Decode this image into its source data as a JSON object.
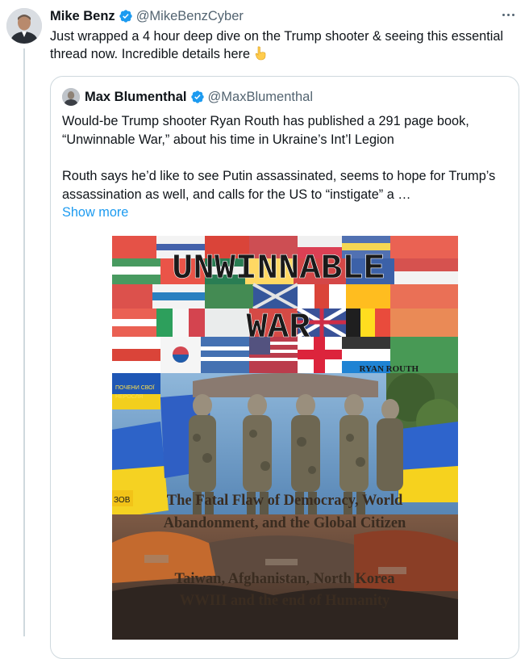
{
  "tweet": {
    "author_name": "Mike Benz",
    "author_handle": "@MikeBenzCyber",
    "text": "Just wrapped a 4 hour deep dive on the Trump shooter & seeing this essential thread now. Incredible details here",
    "emoji": "pointing-down-emoji"
  },
  "quote": {
    "author_name": "Max Blumenthal",
    "author_handle": "@MaxBlumenthal",
    "paragraph_1": "Would-be Trump shooter Ryan Routh has published a 291 page book, “Unwinnable War,” about his time in Ukraine’s Int’l Legion",
    "paragraph_2": "Routh says he’d like to see Putin assassinated, seems to hope for Trump’s assassination as well, and calls for the US to “instigate” a …",
    "show_more": "Show more"
  },
  "book_cover": {
    "title_line1": "UNWINNABLE",
    "title_line2": "WAR",
    "author": "RYAN ROUTH",
    "subtitle_line1": "The Fatal Flaw of Democracy, World",
    "subtitle_line2": "Abandonment, and the Global Citizen",
    "subtitle_line3": "Taiwan, Afghanistan, North Korea",
    "subtitle_line4": "WWIII and the end of Humanity",
    "sign_text": "ЗОВ"
  },
  "colors": {
    "accent": "#1d9bf0",
    "text": "#0f1419",
    "secondary": "#536471",
    "border": "#cfd9de"
  }
}
